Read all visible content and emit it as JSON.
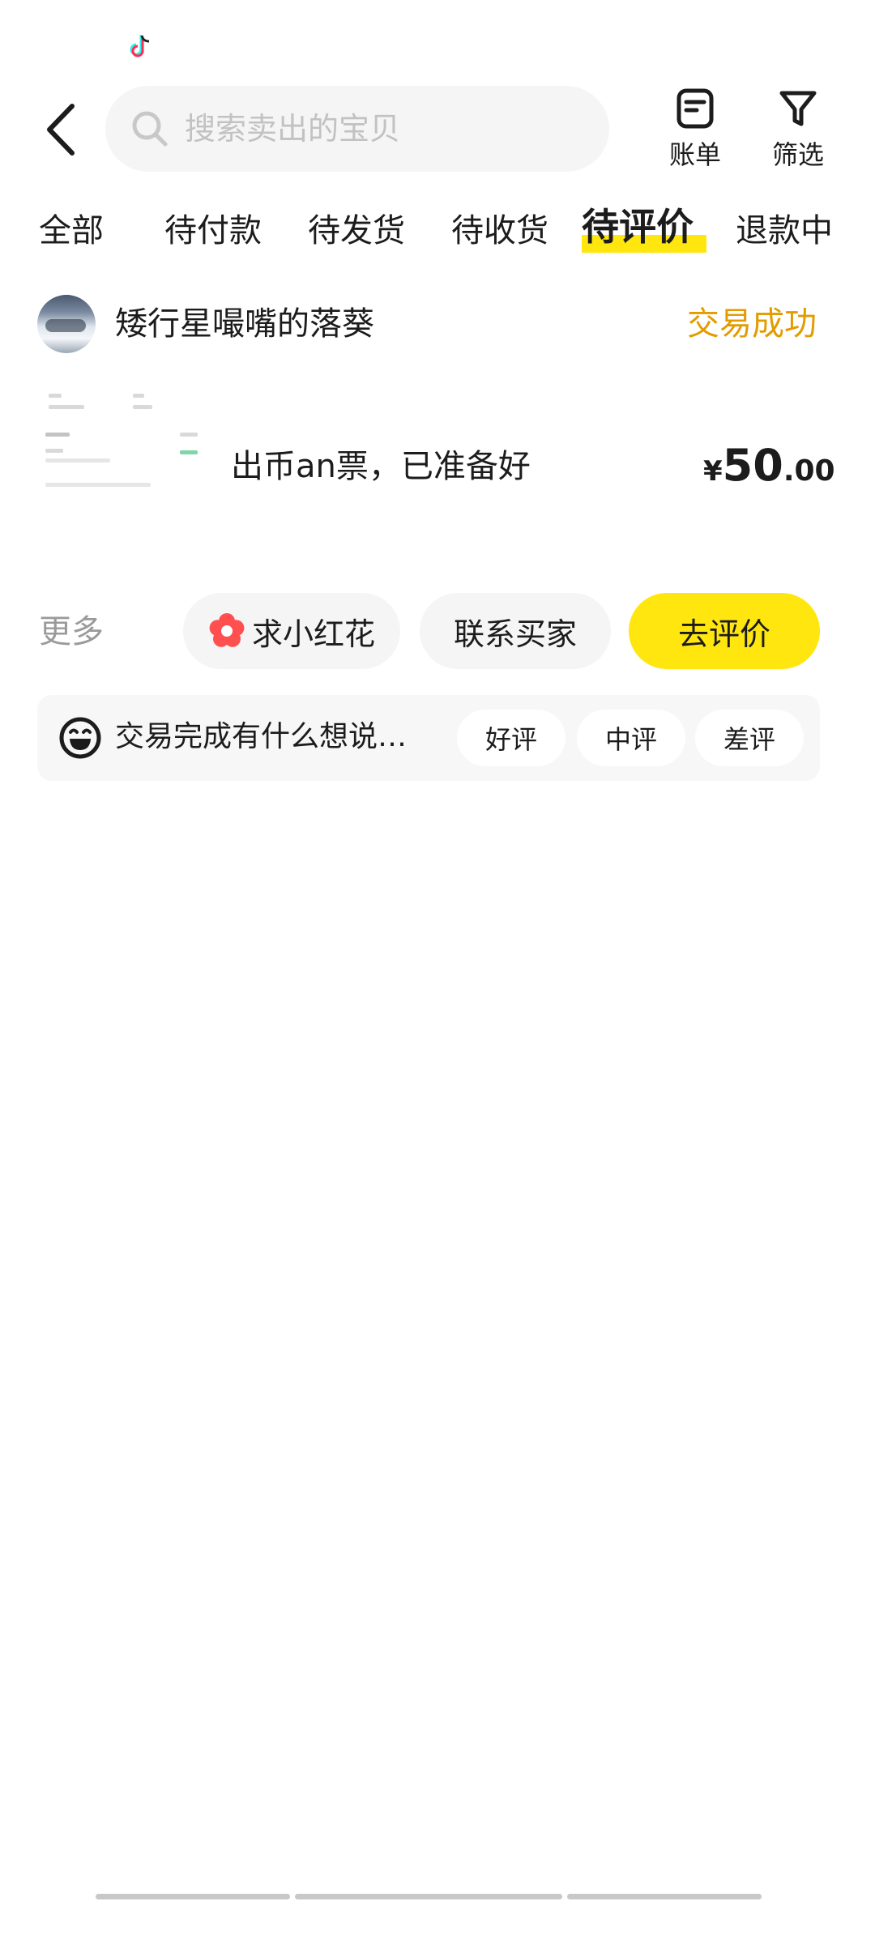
{
  "header": {
    "back_icon": "chevron-left-icon",
    "search_placeholder": "搜索卖出的宝贝",
    "search_value": "",
    "bill_label": "账单",
    "filter_label": "筛选"
  },
  "tabs": [
    {
      "label": "全部",
      "active": false
    },
    {
      "label": "待付款",
      "active": false
    },
    {
      "label": "待发货",
      "active": false
    },
    {
      "label": "待收货",
      "active": false
    },
    {
      "label": "待评价",
      "active": true
    },
    {
      "label": "退款中",
      "active": false
    }
  ],
  "order": {
    "buyer_name": "矮行星嘬嘴的落葵",
    "status": "交易成功",
    "product_title": "出币an票，已准备好",
    "price": {
      "currency": "¥",
      "integer": "50",
      "decimal": ".00"
    },
    "more_label": "更多",
    "actions": {
      "flower": "求小红花",
      "contact": "联系买家",
      "review": "去评价"
    },
    "feedback": {
      "prompt": "交易完成有什么想说…",
      "good": "好评",
      "neutral": "中评",
      "bad": "差评"
    }
  },
  "colors": {
    "accent_yellow": "#ffe60f",
    "status_orange": "#e39c00",
    "flower_red": "#ff4f4f"
  }
}
